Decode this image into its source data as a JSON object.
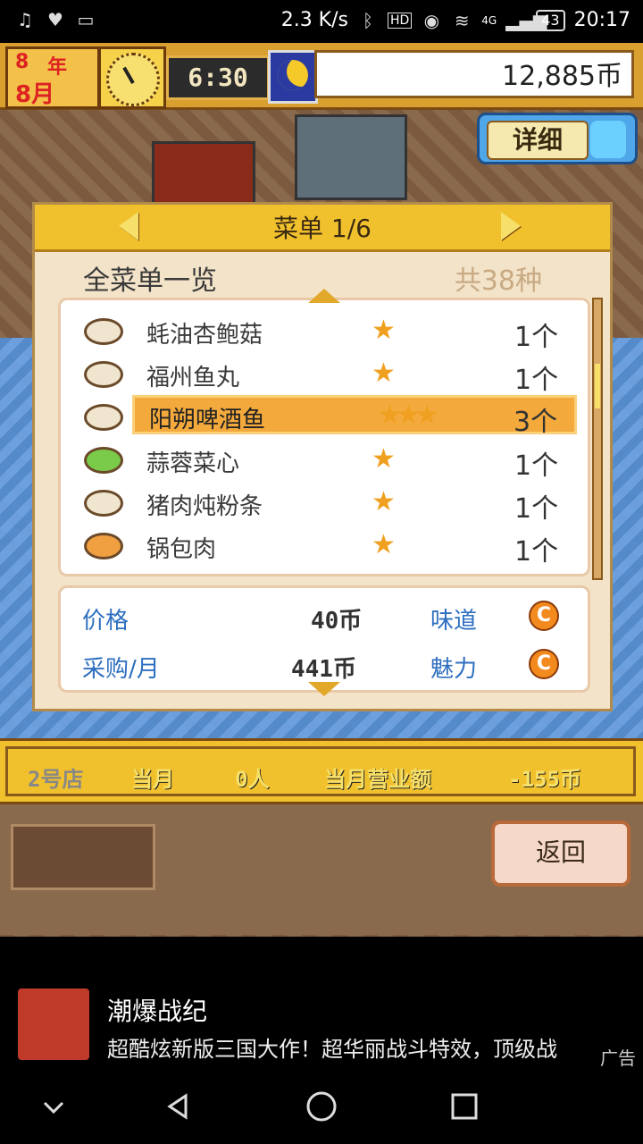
{
  "status_bar": {
    "network_speed": "2.3 K/s",
    "battery": "43",
    "time": "20:17",
    "signal_tag": "4G",
    "hd_tag": "HD"
  },
  "hud": {
    "year_num": "8",
    "year_char": "年",
    "month": "8月",
    "time": "6:30",
    "money": "12,885币",
    "detail_label": "详细"
  },
  "menu": {
    "title": "菜单 1/6",
    "list_heading": "全菜单一览",
    "total": "共38种",
    "dishes": [
      {
        "name": "蚝油杏鲍菇",
        "stars": "★",
        "qty": "1个"
      },
      {
        "name": "福州鱼丸",
        "stars": "★",
        "qty": "1个"
      },
      {
        "name": "阳朔啤酒鱼",
        "stars": "★★★",
        "qty": "3个"
      },
      {
        "name": "蒜蓉菜心",
        "stars": "★",
        "qty": "1个"
      },
      {
        "name": "猪肉炖粉条",
        "stars": "★",
        "qty": "1个"
      },
      {
        "name": "锅包肉",
        "stars": "★",
        "qty": "1个"
      }
    ],
    "info": {
      "price_label": "价格",
      "price_value": "40币",
      "purchase_label": "采购/月",
      "purchase_value": "441币",
      "taste_label": "味道",
      "taste_grade": "C",
      "charm_label": "魅力",
      "charm_grade": "C"
    }
  },
  "bottom_bar": {
    "shop": "2号店",
    "this_month": "当月",
    "visitors": "0人",
    "revenue_label": "当月营业额",
    "revenue_value": "-155币"
  },
  "back_button": "返回",
  "ad": {
    "title": "潮爆战纪",
    "description": "超酷炫新版三国大作！超华丽战斗特效，顶级战",
    "tag": "广告"
  },
  "colors": {
    "accent_gold": "#f1c12d",
    "highlight_row": "#f3a93c",
    "info_label": "#2e6fc0"
  }
}
